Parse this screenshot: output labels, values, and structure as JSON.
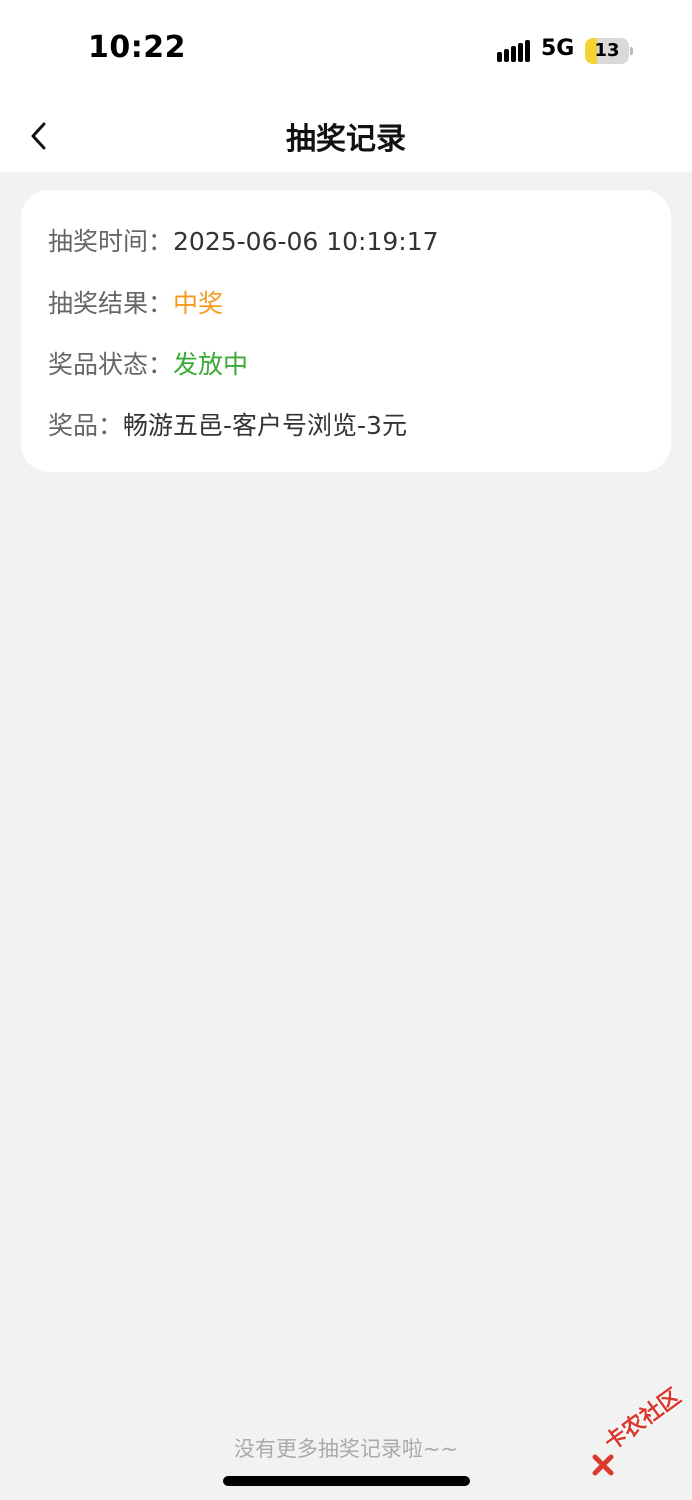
{
  "status_bar": {
    "time": "10:22",
    "network": "5G",
    "battery_level": "13",
    "battery_fraction": 0.13,
    "battery_color": "#f5d431"
  },
  "nav": {
    "back_icon": "chevron-left-icon",
    "title": "抽奖记录"
  },
  "record": {
    "time_label": "抽奖时间：",
    "time_value": "2025-06-06 10:19:17",
    "result_label": "抽奖结果：",
    "result_value": "中奖",
    "result_color": "#f39a1e",
    "status_label": "奖品状态：",
    "status_value": "发放中",
    "status_color": "#3aaa35",
    "prize_label": "奖品：",
    "prize_value": "畅游五邑-客户号浏览-3元"
  },
  "footer": {
    "note": "没有更多抽奖记录啦~~"
  },
  "watermark": {
    "text": "卡农社区",
    "color": "#d83a2d"
  }
}
